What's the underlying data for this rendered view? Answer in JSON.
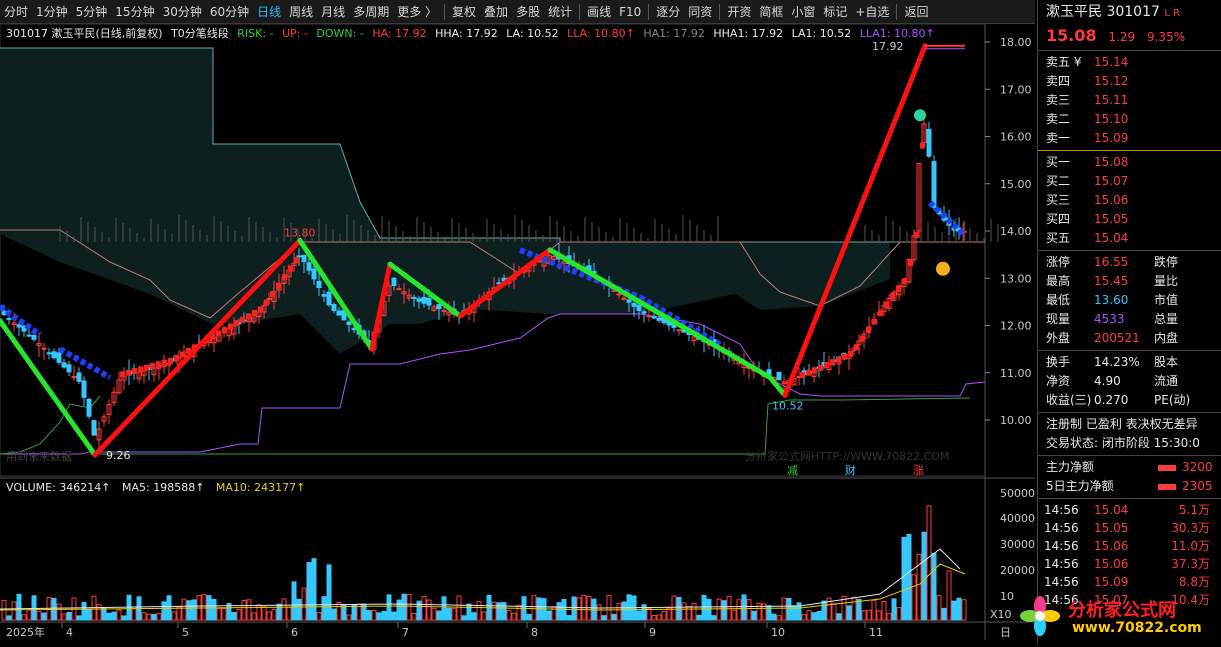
{
  "toolbar": {
    "items": [
      "分时",
      "1分钟",
      "5分钟",
      "15分钟",
      "30分钟",
      "60分钟",
      "日线",
      "周线",
      "月线",
      "多周期",
      "更多 〉",
      "复权",
      "叠加",
      "多股",
      "统计",
      "画线",
      "F10",
      "逐分",
      "同资",
      "开资",
      "简框",
      "小窗",
      "标记",
      "+自选",
      "返回"
    ],
    "active": "日线"
  },
  "info": {
    "title": "301017 漱玉平民(日线,前复权)",
    "indicator": "T0分笔线段",
    "risk": "RISK: -",
    "up": "UP: -",
    "down": "DOWN: -",
    "ha": "HA: 17.92",
    "hha": "HHA: 17.92",
    "la": "LA: 10.52",
    "lla": "LLA: 10.80↑",
    "ha1": "HA1: 17.92",
    "hha1": "HHA1: 17.92",
    "la1": "LA1: 10.52",
    "lla1": "LLA1: 10.80↑"
  },
  "price_axis": [
    "18.00",
    "17.00",
    "16.00",
    "15.00",
    "14.00",
    "13.00",
    "12.00",
    "11.00",
    "10.00"
  ],
  "vol_axis": [
    "50000",
    "40000",
    "30000",
    "20000",
    "10",
    "X10"
  ],
  "date_axis": [
    "2025年",
    "4",
    "5",
    "6",
    "7",
    "8",
    "9",
    "10",
    "11",
    "日"
  ],
  "chart_labels": {
    "high": "17.92",
    "left_high": "13.80",
    "low_left": "9.26",
    "low_mid": "10.52",
    "watermark_left": "用到未来数据",
    "watermark_mid": "分析家公式网HTTP://WWW.70822.COM",
    "marker_jian": "减",
    "marker_cai": "财",
    "marker_zhang": "涨"
  },
  "volume_info": {
    "volume": "VOLUME: 346214↑",
    "ma5": "MA5: 198588↑",
    "ma10": "MA10: 243177↑"
  },
  "quote": {
    "name": "漱玉平民",
    "code": "301017",
    "flags": "L R",
    "price": "15.08",
    "change": "1.29",
    "pct": "9.35%",
    "asks": [
      {
        "label": "卖五 ¥",
        "price": "15.14"
      },
      {
        "label": "卖四",
        "price": "15.12"
      },
      {
        "label": "卖三",
        "price": "15.11"
      },
      {
        "label": "卖二",
        "price": "15.10"
      },
      {
        "label": "卖一",
        "price": "15.09"
      }
    ],
    "bids": [
      {
        "label": "买一",
        "price": "15.08"
      },
      {
        "label": "买二",
        "price": "15.07"
      },
      {
        "label": "买三",
        "price": "15.06"
      },
      {
        "label": "买四",
        "price": "15.05"
      },
      {
        "label": "买五",
        "price": "15.04"
      }
    ],
    "stats": [
      {
        "k": "涨停",
        "v": "16.55",
        "x": "跌停"
      },
      {
        "k": "最高",
        "v": "15.45",
        "x": "量比"
      },
      {
        "k": "最低",
        "v": "13.60",
        "x": "市值"
      },
      {
        "k": "现量",
        "v": "4533",
        "x": "总量"
      },
      {
        "k": "外盘",
        "v": "200521",
        "x": "内盘"
      }
    ],
    "stats2": [
      {
        "k": "换手",
        "v": "14.23%",
        "x": "股本"
      },
      {
        "k": "净资",
        "v": "4.90",
        "x": "流通"
      },
      {
        "k": "收益(三)",
        "v": "0.270",
        "x": "PE(动)"
      }
    ],
    "tags": "注册制 已盈利 表决权无差异",
    "status": "交易状态: 闭市阶段 15:30:0",
    "main_net_label": "主力净额",
    "main_net": "3200",
    "main_net5_label": "5日主力净额",
    "main_net5": "2305",
    "ticks": [
      {
        "t": "14:56",
        "p": "15.04",
        "q": "5.1万"
      },
      {
        "t": "14:56",
        "p": "15.05",
        "q": "30.3万"
      },
      {
        "t": "14:56",
        "p": "15.06",
        "q": "11.0万"
      },
      {
        "t": "14:56",
        "p": "15.06",
        "q": "37.3万"
      },
      {
        "t": "14:56",
        "p": "15.09",
        "q": "8.8万"
      },
      {
        "t": "14:56",
        "p": "15.07",
        "q": "10.4万"
      }
    ]
  },
  "logo": {
    "name": "分析家公式网",
    "url": "www.70822.com"
  },
  "colors": {
    "up": "#ff3c3c",
    "down": "#25d22d",
    "blue": "#2040ff",
    "cyan": "#35c8ff",
    "purple": "#b050ff"
  }
}
